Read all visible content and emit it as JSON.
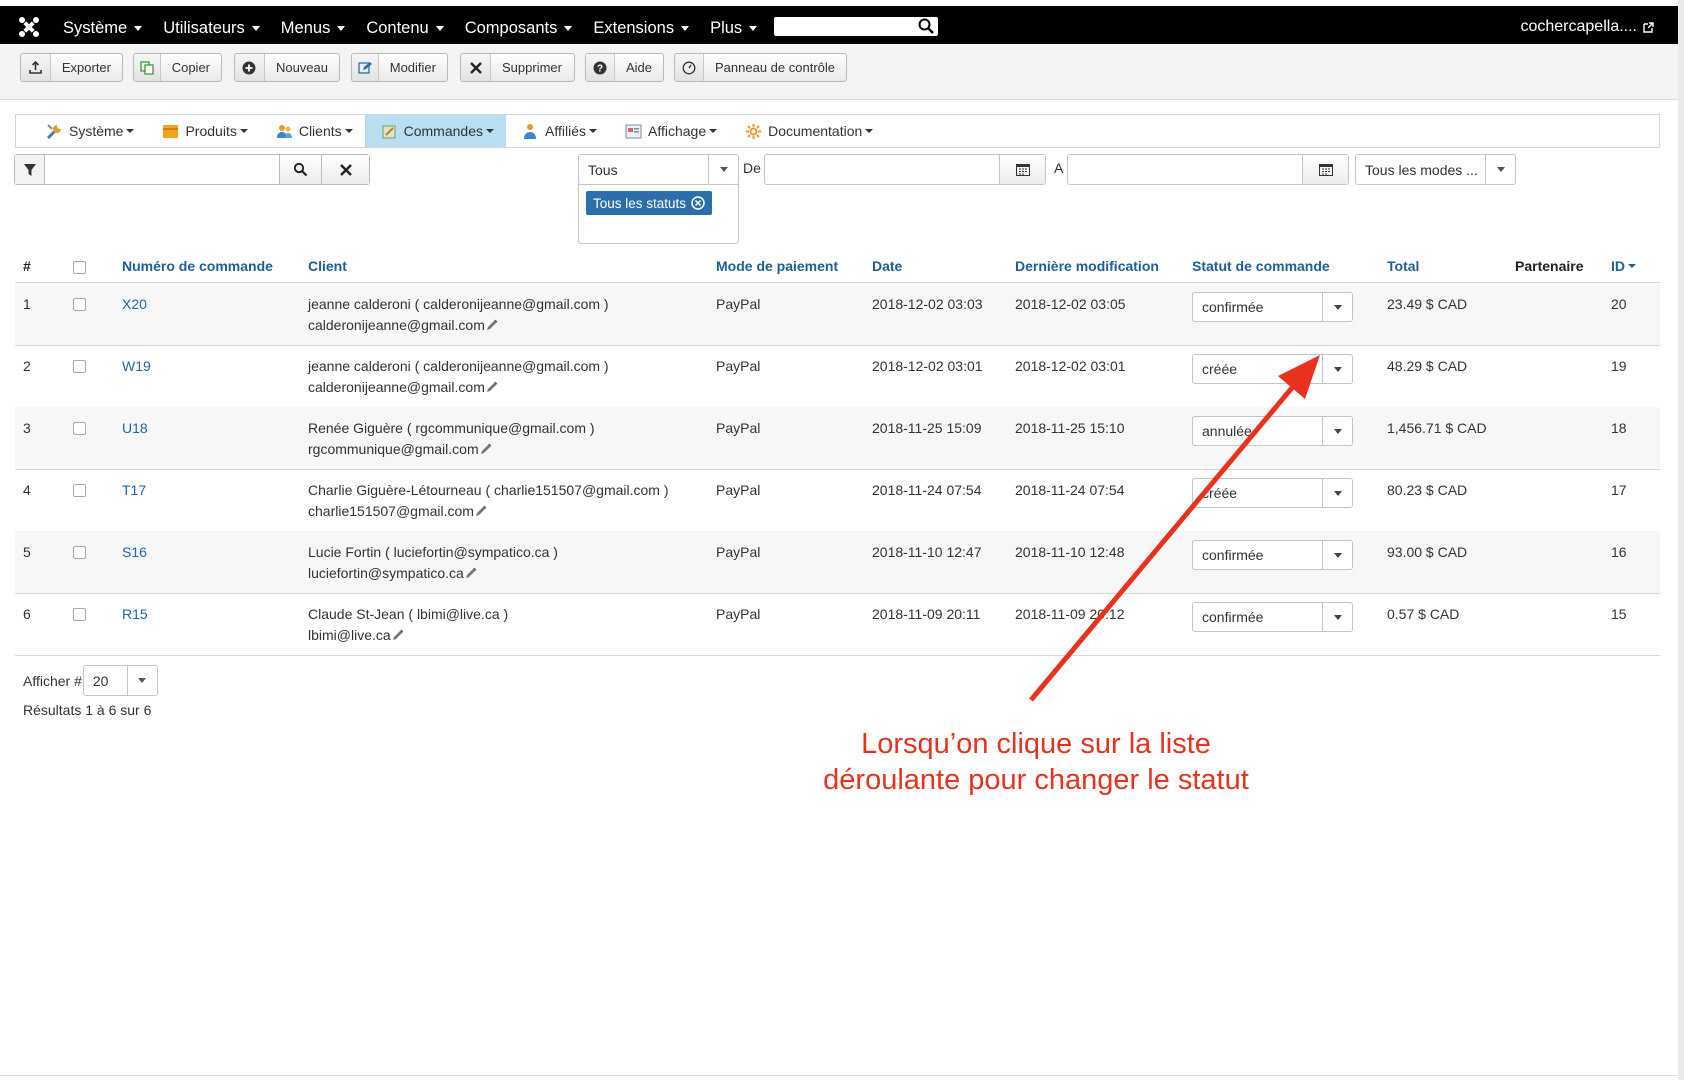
{
  "topnav": {
    "menus": [
      "Système",
      "Utilisateurs",
      "Menus",
      "Contenu",
      "Composants",
      "Extensions",
      "Plus"
    ],
    "user": "cochercapella...."
  },
  "toolbar": {
    "buttons": [
      "Exporter",
      "Copier",
      "Nouveau",
      "Modifier",
      "Supprimer",
      "Aide",
      "Panneau de contrôle"
    ]
  },
  "submenu": {
    "items": [
      "Système",
      "Produits",
      "Clients",
      "Commandes",
      "Affiliés",
      "Affichage",
      "Documentation"
    ],
    "active": "Commandes"
  },
  "filters": {
    "search_value": "",
    "type_select": "Tous",
    "from_label": "De",
    "to_label": "A",
    "payment_select": "Tous les modes ...",
    "status_tag": "Tous les statuts"
  },
  "table": {
    "headers": {
      "num": "#",
      "order": "Numéro de commande",
      "client": "Client",
      "payment": "Mode de paiement",
      "date": "Date",
      "modified": "Dernière modification",
      "status": "Statut de commande",
      "total": "Total",
      "partner": "Partenaire",
      "id": "ID"
    },
    "rows": [
      {
        "n": "1",
        "order": "X20",
        "client": "jeanne calderoni ( calderonijeanne@gmail.com )",
        "email": "calderonijeanne@gmail.com",
        "payment": "PayPal",
        "date": "2018-12-02 03:03",
        "modified": "2018-12-02 03:05",
        "status": "confirmée",
        "total": "23.49 $ CAD",
        "id": "20"
      },
      {
        "n": "2",
        "order": "W19",
        "client": "jeanne calderoni ( calderonijeanne@gmail.com )",
        "email": "calderonijeanne@gmail.com",
        "payment": "PayPal",
        "date": "2018-12-02 03:01",
        "modified": "2018-12-02 03:01",
        "status": "créée",
        "total": "48.29 $ CAD",
        "id": "19"
      },
      {
        "n": "3",
        "order": "U18",
        "client": "Renée Giguère ( rgcommunique@gmail.com )",
        "email": "rgcommunique@gmail.com",
        "payment": "PayPal",
        "date": "2018-11-25 15:09",
        "modified": "2018-11-25 15:10",
        "status": "annulée",
        "total": "1,456.71 $ CAD",
        "id": "18"
      },
      {
        "n": "4",
        "order": "T17",
        "client": "Charlie Giguère-Létourneau ( charlie151507@gmail.com )",
        "email": "charlie151507@gmail.com",
        "payment": "PayPal",
        "date": "2018-11-24 07:54",
        "modified": "2018-11-24 07:54",
        "status": "créée",
        "total": "80.23 $ CAD",
        "id": "17"
      },
      {
        "n": "5",
        "order": "S16",
        "client": "Lucie Fortin ( luciefortin@sympatico.ca )",
        "email": "luciefortin@sympatico.ca",
        "payment": "PayPal",
        "date": "2018-11-10 12:47",
        "modified": "2018-11-10 12:48",
        "status": "confirmée",
        "total": "93.00 $ CAD",
        "id": "16"
      },
      {
        "n": "6",
        "order": "R15",
        "client": "Claude St-Jean ( lbimi@live.ca )",
        "email": "lbimi@live.ca",
        "payment": "PayPal",
        "date": "2018-11-09 20:11",
        "modified": "2018-11-09 20:12",
        "status": "confirmée",
        "total": "0.57 $ CAD",
        "id": "15"
      }
    ]
  },
  "pager": {
    "show_label": "Afficher #",
    "limit": "20",
    "results": "Résultats 1 à 6 sur 6"
  },
  "annotation": {
    "line1": "Lorsqu’on clique sur la liste",
    "line2": "déroulante pour changer le statut",
    "color": "#e8321e"
  }
}
